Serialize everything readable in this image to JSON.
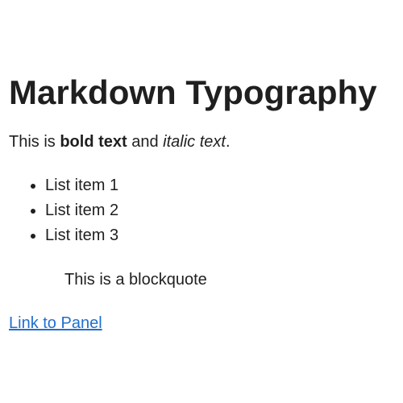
{
  "heading": {
    "text": "Markdown Typography"
  },
  "paragraph": {
    "prefix": "This is ",
    "bold": "bold text",
    "middle": " and ",
    "italic": "italic text",
    "suffix": "."
  },
  "list": {
    "items": [
      {
        "label": "List item 1"
      },
      {
        "label": "List item 2"
      },
      {
        "label": "List item 3"
      }
    ]
  },
  "blockquote": {
    "text": "This is a blockquote"
  },
  "link": {
    "text": "Link to Panel",
    "color": "#1f6fd0"
  }
}
